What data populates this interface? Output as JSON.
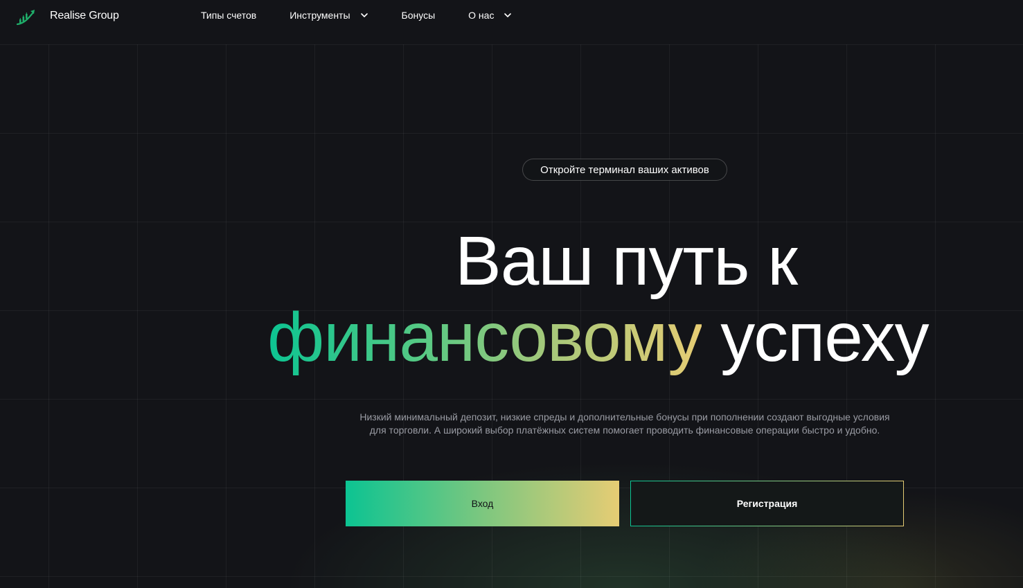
{
  "header": {
    "brand": "Realise Group",
    "nav": [
      {
        "label": "Типы счетов",
        "has_dropdown": false
      },
      {
        "label": "Инструменты",
        "has_dropdown": true,
        "icon": "chevron-down-icon"
      },
      {
        "label": "Бонусы",
        "has_dropdown": false
      },
      {
        "label": "О нас",
        "has_dropdown": true,
        "icon": "chevron-down-icon"
      }
    ],
    "logo_icon": "rising-chart-logo-icon"
  },
  "hero": {
    "pill": "Откройте терминал ваших активов",
    "headline_line1": "Ваш путь к",
    "headline_line2_accent": "финансовому",
    "headline_line2_rest": " успеху",
    "description_line1": "Низкий минимальный депозит, низкие спреды и дополнительные бонусы при пополнении создают выгодные условия",
    "description_line2": "для торговли. А широкий выбор платёжных систем помогает проводить финансовые операции быстро и удобно.",
    "login_button": "Вход",
    "register_button": "Регистрация"
  },
  "colors": {
    "background": "#131418",
    "accent_green": "#0cc492",
    "accent_gold": "#e6cc74",
    "muted_text": "#9a9ca4"
  }
}
